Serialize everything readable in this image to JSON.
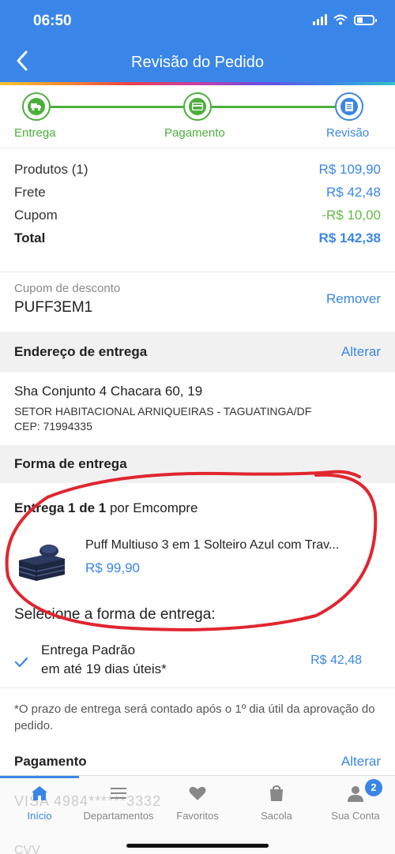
{
  "status_bar": {
    "time": "06:50"
  },
  "header": {
    "title": "Revisão do Pedido"
  },
  "steps": [
    {
      "label": "Entrega",
      "state": "done"
    },
    {
      "label": "Pagamento",
      "state": "done"
    },
    {
      "label": "Revisão",
      "state": "current"
    }
  ],
  "summary": {
    "products_label": "Produtos (1)",
    "products_value": "R$ 109,90",
    "shipping_label": "Frete",
    "shipping_value": "R$ 42,48",
    "coupon_label": "Cupom",
    "coupon_value": "-R$ 10,00",
    "total_label": "Total",
    "total_value": "R$ 142,38"
  },
  "coupon": {
    "label": "Cupom de desconto",
    "code": "PUFF3EM1",
    "remove": "Remover"
  },
  "address_section": {
    "title": "Endereço de entrega",
    "action": "Alterar"
  },
  "address": {
    "line1": "Sha Conjunto 4 Chacara 60, 19",
    "line2": "SETOR HABITACIONAL ARNIQUEIRAS - TAGUATINGA/DF",
    "line3": "CEP: 71994335"
  },
  "delivery_section": {
    "title": "Forma de entrega"
  },
  "delivery": {
    "count": "Entrega 1 de 1",
    "by": "por Emcompre",
    "product_name": "Puff Multiuso 3 em 1 Solteiro Azul com Trav...",
    "product_price": "R$ 99,90",
    "select_title": "Selecione a forma de entrega:",
    "option_name": "Entrega Padrão",
    "option_sub": "em até 19 dias úteis*",
    "option_price": "R$ 42,48",
    "note": "*O prazo de entrega será contado após o 1º dia útil da aprovação do pedido."
  },
  "payment_section": {
    "title": "Pagamento",
    "action": "Alterar",
    "card_partial": "VISA  4984******3332",
    "cvv_partial": "CVV"
  },
  "tabbar": {
    "items": [
      {
        "label": "Início",
        "icon": "home-icon"
      },
      {
        "label": "Departamentos",
        "icon": "list-icon"
      },
      {
        "label": "Favoritos",
        "icon": "heart-icon"
      },
      {
        "label": "Sacola",
        "icon": "bag-icon"
      },
      {
        "label": "Sua Conta",
        "icon": "user-icon"
      }
    ],
    "account_badge": "2"
  },
  "colors": {
    "primary": "#3a86e8",
    "success": "#4caf3c",
    "annotation": "#e02630"
  }
}
